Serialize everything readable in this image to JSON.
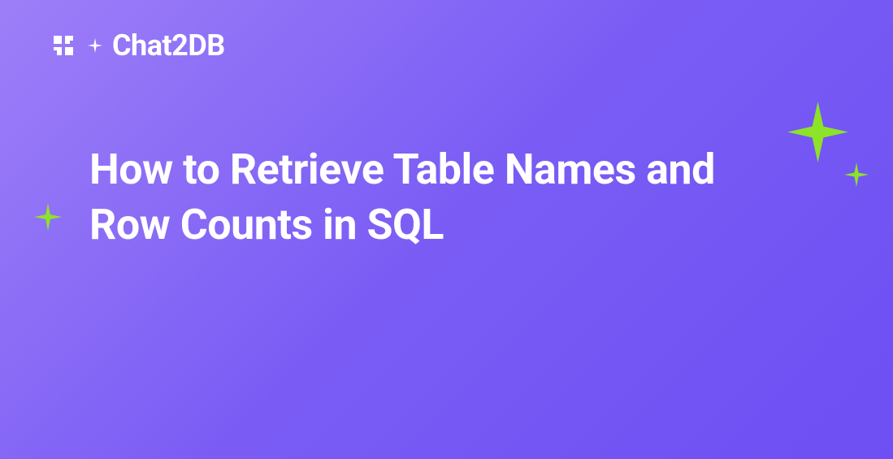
{
  "brand": {
    "name": "Chat2DB"
  },
  "heading": "How to Retrieve Table Names and Row Counts in SQL",
  "colors": {
    "background_start": "#9d7ff8",
    "background_end": "#6d4ff3",
    "text": "#ffffff",
    "accent": "#8de328"
  }
}
